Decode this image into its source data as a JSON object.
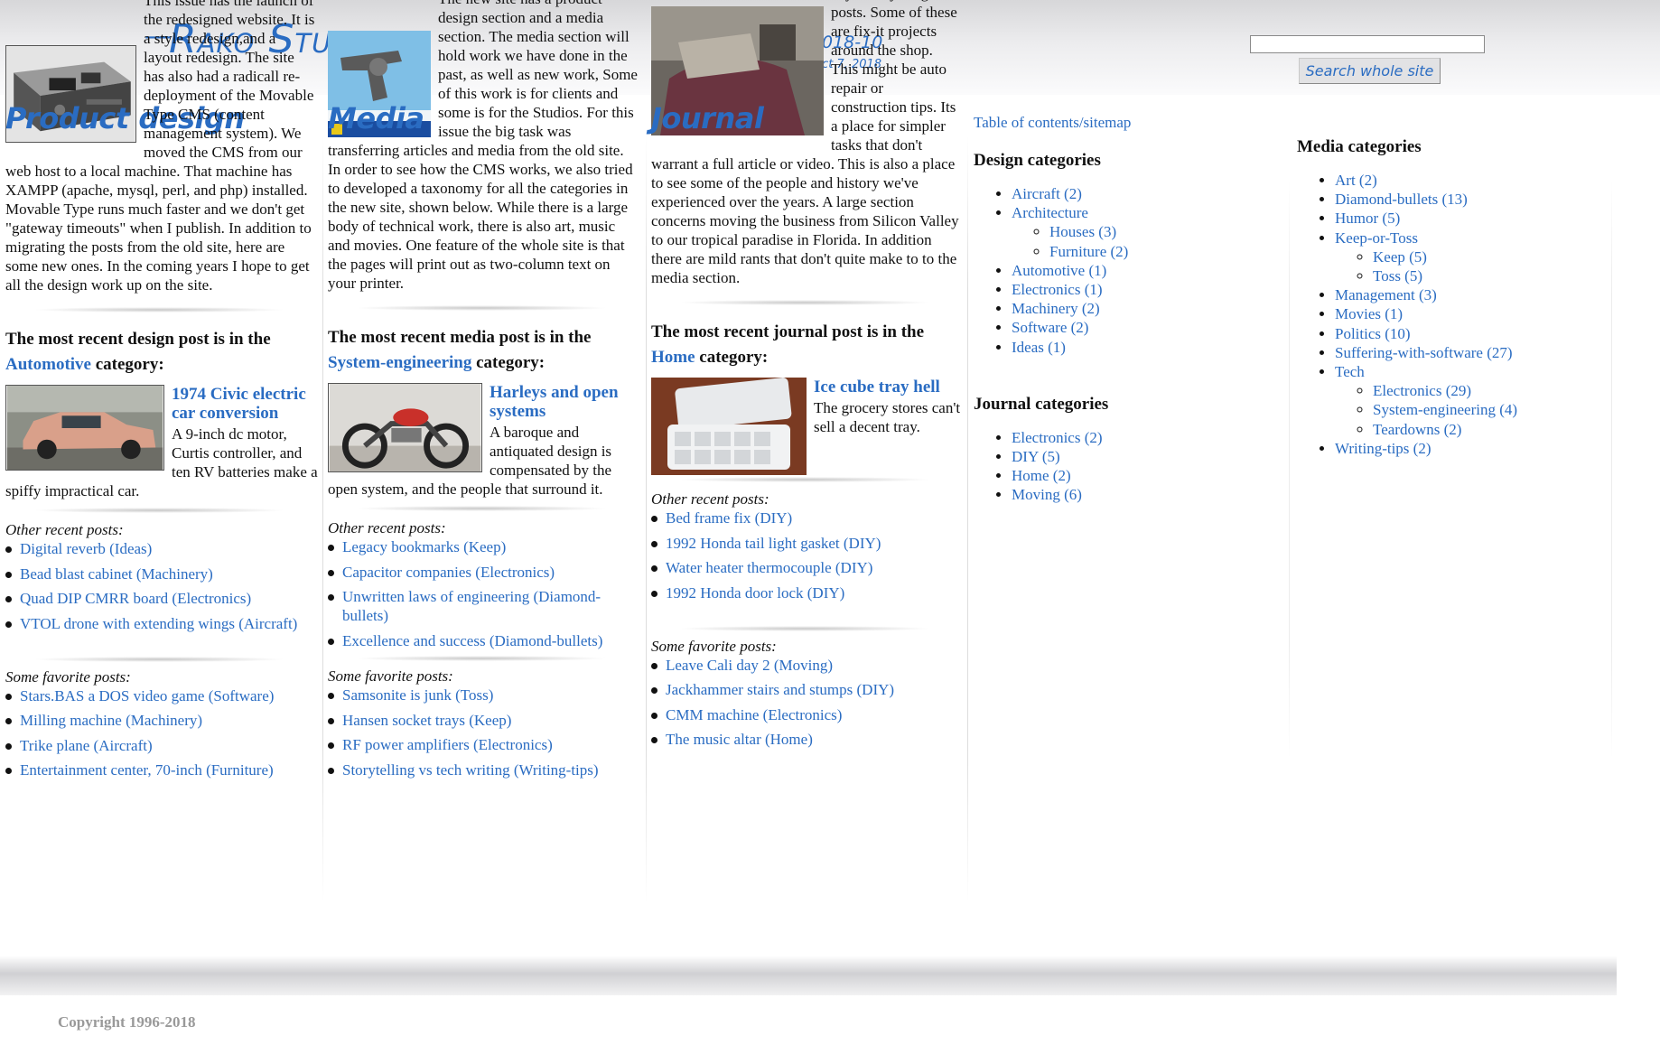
{
  "header": {
    "logo": "Rako Studios",
    "issue_title": "Issue 2018-10",
    "issue_date": "Sunday, Oct 7, 2018",
    "search_button": "Search whole site",
    "search_value": ""
  },
  "product": {
    "title": "Product design",
    "intro": "This issue has the launch of the redesigned website. It is a style redesign,and a layout redesign. The site has also had a radicall re-deployment of the Movable Type CMS (content management system). We moved the CMS from our web host to a local machine. That machine has XAMPP (apache, mysql, perl, and php) installed. Movable Type runs much faster and we don't get \"gateway timeouts\" when I publish. In addition to migrating the posts from the old site, here are some new ones. In the coming years I hope to get all the design work up on the site.",
    "recent_prefix": "The most recent design post is in the",
    "recent_category": "Automotive",
    "recent_suffix": "category:",
    "post_title": "1974 Civic electric car conversion",
    "post_text": "A 9-inch dc motor, Curtis controller, and ten RV batteries make a spiffy impractical car.",
    "other_label": "Other recent posts:",
    "other": [
      "Digital reverb (Ideas)",
      "Bead blast cabinet (Machinery)",
      "Quad DIP CMRR board (Electronics)",
      "VTOL drone with extending wings (Aircraft)"
    ],
    "fav_label": "Some favorite posts:",
    "favorites": [
      "Stars.BAS a DOS video game (Software)",
      "Milling machine (Machinery)",
      "Trike plane (Aircraft)",
      "Entertainment center, 70-inch (Furniture)"
    ]
  },
  "media": {
    "title": "Media",
    "intro": "The new site has a product design section and a media section. The media section will hold work we have done in the past, as well as new work, Some of this work is for clients and some is for the Studios. For this issue the big task was transferring articles and media from the old site. In order to see how the CMS works, we also tried to developed a taxonomy for all the categories in the new site, shown below. While there is a large body of technical work, there is also art, music and movies. One feature of the whole site is that the pages will print out as two-column text on your printer.",
    "recent_prefix": "The most recent media post is in the",
    "recent_category": "System-engineering",
    "recent_suffix": "category:",
    "post_title": "Harleys and open systems",
    "post_text": "A baroque and antiquated design is compensated by the open system, and the people that surround it.",
    "other_label": "Other recent posts:",
    "other": [
      "Legacy bookmarks (Keep)",
      "Capacitor companies (Electronics)",
      "Unwritten laws of engineering (Diamond-bullets)",
      "Excellence and success (Diamond-bullets)"
    ],
    "fav_label": "Some favorite posts:",
    "favorites": [
      "Samsonite is junk (Toss)",
      "Hansen socket trays (Keep)",
      "RF power amplifiers (Electronics)",
      "Storytelling vs tech writing (Writing-tips)"
    ]
  },
  "journal": {
    "title": "Journal",
    "intro": "Besides product designs and media there is plenty of day-to-day blog posts. Some of these are fix-it projects around the shop. This might be auto repair or construction tips. Its a place for simpler tasks that don't warrant a full article or video. This is also a place to see some of the people and history we've experienced over the years. A large section concerns moving the business from Silicon Valley to our tropical paradise in Florida. In addition there are mild rants that don't quite make to to the media section.",
    "recent_prefix": "The most recent journal post is in the",
    "recent_category": "Home",
    "recent_suffix": "category:",
    "post_title": "Ice cube tray hell",
    "post_text": "The grocery stores can't sell a decent tray.",
    "other_label": "Other recent posts:",
    "other": [
      "Bed frame fix (DIY)",
      "1992 Honda tail light gasket (DIY)",
      "Water heater thermocouple (DIY)",
      "1992 Honda door lock (DIY)"
    ],
    "fav_label": "Some favorite posts:",
    "favorites": [
      "Leave Cali day 2 (Moving)",
      "Jackhammer stairs and stumps (DIY)",
      "CMM machine (Electronics)",
      "The music altar (Home)"
    ]
  },
  "sidebar": {
    "toc": "Table of contents/sitemap",
    "design_heading": "Design categories",
    "design": [
      {
        "label": "Aircraft (2)"
      },
      {
        "label": "Architecture",
        "children": [
          "Houses (3)",
          "Furniture (2)"
        ]
      },
      {
        "label": "Automotive (1)"
      },
      {
        "label": "Electronics (1)"
      },
      {
        "label": "Machinery (2)"
      },
      {
        "label": "Software (2)"
      },
      {
        "label": "Ideas (1)"
      }
    ],
    "journal_heading": "Journal categories",
    "journal": [
      "Electronics (2)",
      "DIY (5)",
      "Home (2)",
      "Moving (6)"
    ],
    "media_heading": "Media categories",
    "media": [
      {
        "label": "Art (2)"
      },
      {
        "label": "Diamond-bullets (13)"
      },
      {
        "label": "Humor (5)"
      },
      {
        "label": "Keep-or-Toss",
        "children": [
          "Keep (5)",
          "Toss (5)"
        ]
      },
      {
        "label": "Management (3)"
      },
      {
        "label": "Movies (1)"
      },
      {
        "label": "Politics (10)"
      },
      {
        "label": "Suffering-with-software (27)"
      },
      {
        "label": "Tech",
        "children": [
          "Electronics (29)",
          "System-engineering (4)",
          "Teardowns (2)"
        ]
      },
      {
        "label": "Writing-tips (2)"
      }
    ]
  },
  "footer": {
    "copyright": "Copyright 1996-2018"
  },
  "colors": {
    "link": "#2a6cc2",
    "text": "#111111",
    "footer_text": "#999999"
  }
}
